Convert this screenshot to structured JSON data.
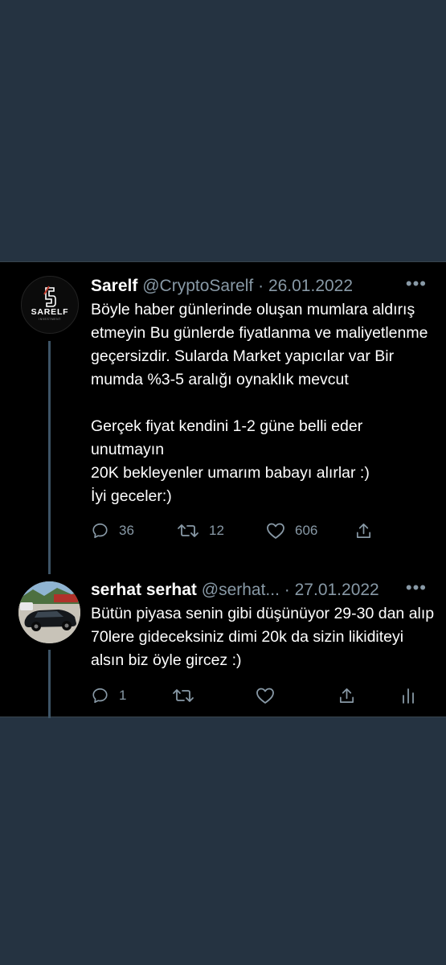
{
  "tweet": {
    "name": "Sarelf",
    "handle": "@CryptoSarelf",
    "separator": "·",
    "date": "26.01.2022",
    "more": "•••",
    "text": "Böyle haber günlerinde oluşan mumlara aldırış etmeyin Bu günlerde fiyatlanma ve maliyetlenme geçersizdir. Sularda Market yapıcılar var Bir mumda %3-5 aralığı oynaklık mevcut\n\nGerçek fiyat kendini 1-2 güne belli eder unutmayın\n20K bekleyenler umarım babayı alırlar :)\nİyi geceler:)",
    "avatar_logo": "SARELF",
    "avatar_tagline": "INVESTMENT",
    "replies": "36",
    "retweets": "12",
    "likes": "606"
  },
  "reply": {
    "name": "serhat serhat",
    "handle": "@serhat...",
    "separator": "·",
    "date": "27.01.2022",
    "more": "•••",
    "text": "Bütün piyasa senin gibi düşünüyor 29-30 dan alıp 70lere gideceksiniz dimi 20k da sizin likiditeyi alsın biz öyle gircez :)",
    "replies": "1"
  },
  "colors": {
    "page_bg": "#253341",
    "panel_bg": "#000000",
    "text": "#ffffff",
    "muted": "#8899a6",
    "thread_line": "#3d5466"
  }
}
